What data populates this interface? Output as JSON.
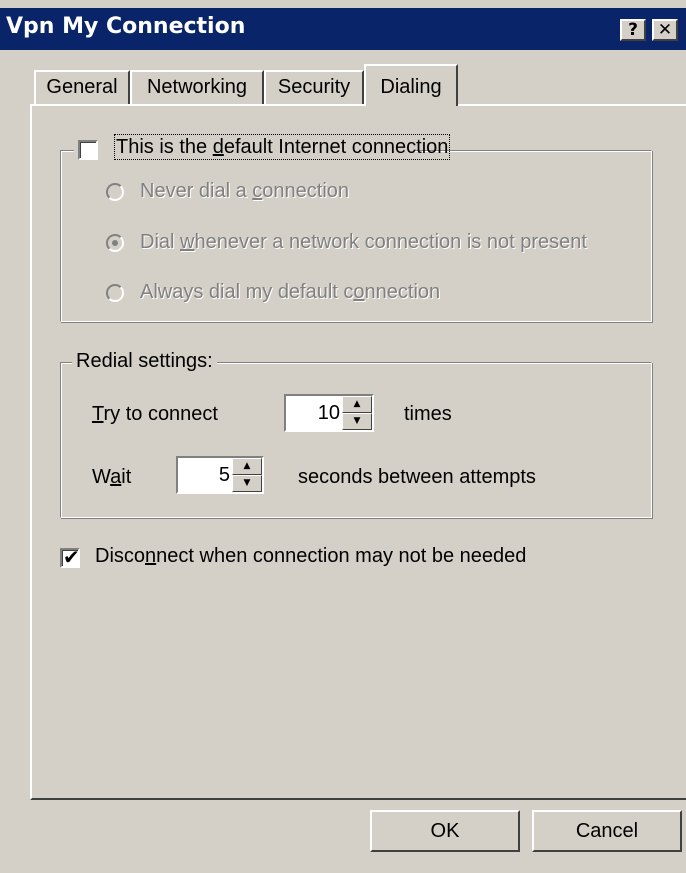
{
  "window": {
    "title": "Vpn My Connection",
    "help_label": "?",
    "close_label": "✕"
  },
  "tabs": [
    {
      "label": "General"
    },
    {
      "label": "Networking"
    },
    {
      "label": "Security"
    },
    {
      "label": "Dialing",
      "active": true
    }
  ],
  "default_connection": {
    "label_pre": "This is the ",
    "label_key": "d",
    "label_post": "efault Internet connection",
    "checked": false,
    "check_glyph": "",
    "options": [
      {
        "pre": "Never dial a ",
        "key": "c",
        "post": "onnection",
        "selected": false
      },
      {
        "pre": "Dial ",
        "key": "w",
        "post": "henever a network connection is not present",
        "selected": true
      },
      {
        "pre": "Always dial my default c",
        "key": "o",
        "post": "nnection",
        "selected": false
      }
    ]
  },
  "redial": {
    "title": "Redial settings:",
    "try_key": "T",
    "try_rest": "ry to connect",
    "try_value": "10",
    "try_suffix": "times",
    "wait_pre": "W",
    "wait_key": "a",
    "wait_post": "it",
    "wait_value": "5",
    "wait_suffix": "seconds between attempts",
    "spin_up": "▲",
    "spin_down": "▼"
  },
  "disconnect": {
    "checked": true,
    "check_glyph": "✔",
    "pre": "Disco",
    "key": "n",
    "post": "nect when connection may not be needed"
  },
  "buttons": {
    "ok": "OK",
    "cancel": "Cancel"
  }
}
